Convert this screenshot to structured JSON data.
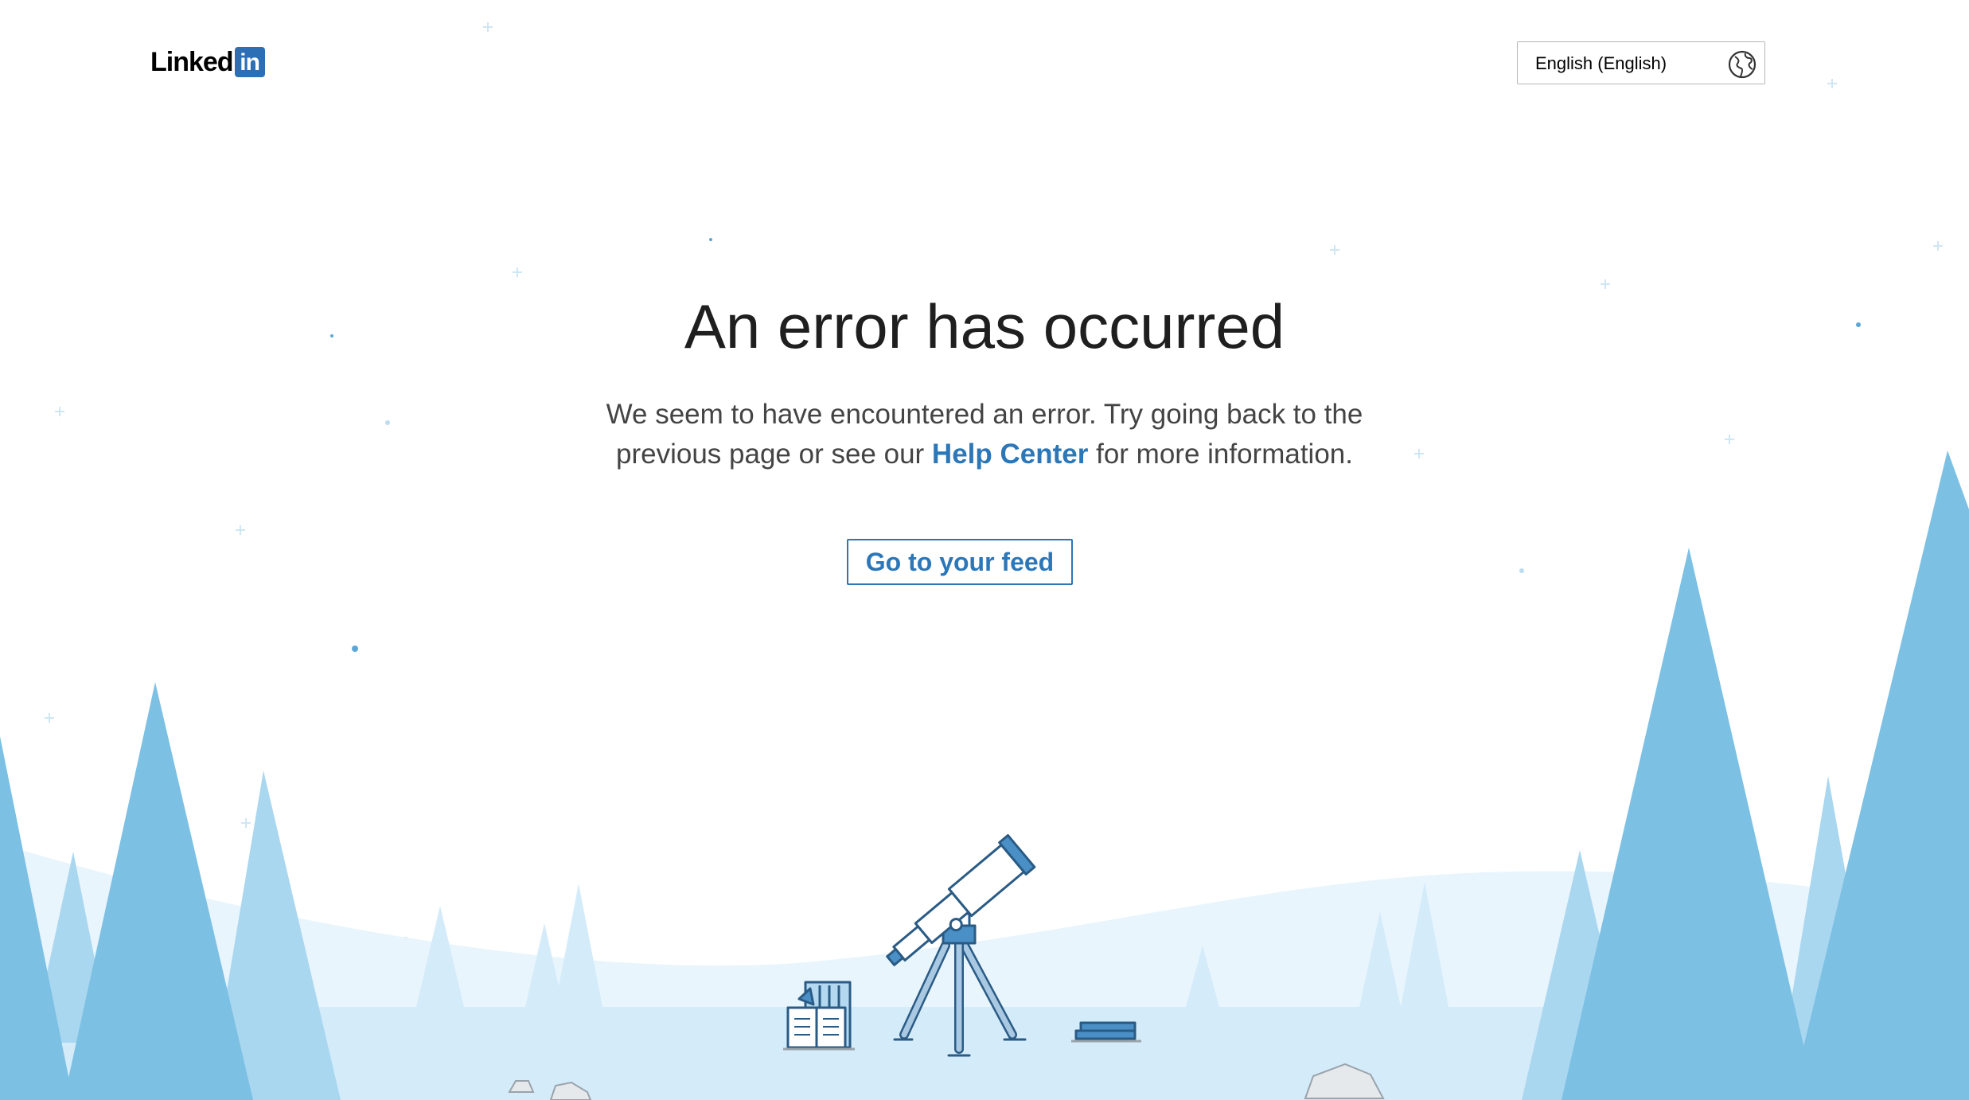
{
  "header": {
    "logo_text": "Linked",
    "logo_badge": "in",
    "language_label": "English (English)",
    "language_icon": "globe-icon"
  },
  "error": {
    "title": "An error has occurred",
    "message_part1": "We seem to have encountered an error. Try going back to the",
    "message_part2": "previous page or see our",
    "help_link": "Help Center",
    "message_part3": "for more information."
  },
  "actions": {
    "feed_button": "Go to your feed"
  },
  "colors": {
    "accent": "#2c77b8",
    "tree_dark": "#7cc0e4",
    "tree_light": "#a9d7ef",
    "ground": "#d4ebfa",
    "hill": "#e9f5fd"
  },
  "illustration": {
    "icons": [
      "telescope-icon",
      "book-icon",
      "books-stack-icon",
      "rock-icon",
      "pine-tree-icon",
      "star-icon"
    ]
  }
}
